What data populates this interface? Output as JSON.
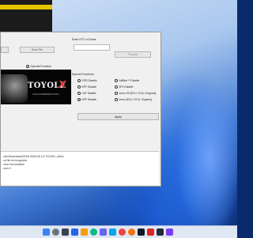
{
  "window": {
    "save_file_label": "Save File",
    "special_function_label": "Special Function",
    "banner": {
      "logo_text": "TOYOLE",
      "logo_mark": "X",
      "tagline": "A FULL EXPERIENCE IN DIAG"
    },
    "dtc_label": "Enter DTC to Erase",
    "proceed_label": "Proceed",
    "special_functions_label": "Special Functions",
    "options": [
      {
        "label": "EGR Disable",
        "selected": false
      },
      {
        "label": "AdBlue™ Disable",
        "selected": false
      },
      {
        "label": "DPF Disable",
        "selected": false
      },
      {
        "label": "3FX Disable",
        "selected": false
      },
      {
        "label": "CAT Disable",
        "selected": false
      },
      {
        "label": "Immo Off [ECU / ECU. Engines]",
        "selected": false
      },
      {
        "label": "DPF Disable",
        "selected": true
      },
      {
        "label": "Immo [ECU / ECU. Engines]",
        "selected": false
      }
    ],
    "apply_label": "Apply",
    "log_lines": [
      "...ultor\\Downloads\\SSAN 5SU6-KE-LIF 2012301_off.bin",
      "...on file be recognized.",
      "...ction Not available.",
      "...sion: 0"
    ]
  },
  "colors": {
    "accent": "#e3c200",
    "selection": "#1f6ad6"
  },
  "taskbar": {
    "icons": [
      "start-icon",
      "search-icon",
      "task-view-icon",
      "widgets-icon",
      "file-explorer-icon",
      "edge-icon",
      "store-icon",
      "mail-icon",
      "chrome-icon",
      "firefox-icon",
      "app-icon",
      "app-icon-2",
      "app-icon-3",
      "app-icon-4"
    ]
  }
}
